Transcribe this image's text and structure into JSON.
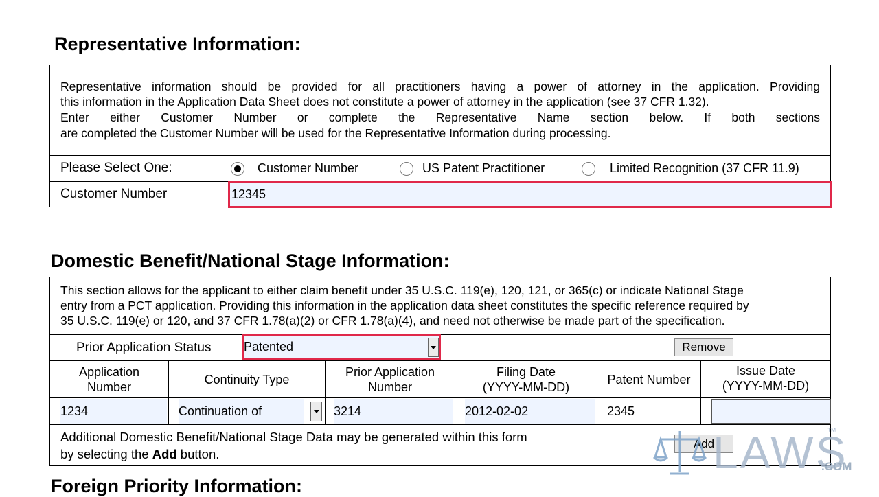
{
  "rep": {
    "heading": "Representative Information:",
    "intro_lines": [
      "Representative information should be provided for all practitioners having a power of attorney in the application. Providing",
      "this information in the Application Data Sheet does not constitute a power of attorney in the application (see 37 CFR 1.32).",
      "Enter either Customer Number or complete the Representative Name section below. If both sections",
      "are completed the Customer Number will be used for the Representative Information during processing."
    ],
    "select_label": "Please Select One:",
    "options": [
      "Customer Number",
      "US Patent Practitioner",
      "Limited Recognition (37 CFR 11.9)"
    ],
    "selected_option": "Customer Number",
    "customer_number_label": "Customer Number",
    "customer_number_value": "12345"
  },
  "domestic": {
    "heading": "Domestic Benefit/National Stage Information:",
    "intro_lines": [
      "This section allows for the applicant to either claim benefit under 35 U.S.C. 119(e), 120, 121, or 365(c) or indicate National Stage",
      "entry from a PCT application. Providing this information in the application data sheet constitutes the specific reference required by",
      "35 U.S.C. 119(e) or 120, and 37 CFR 1.78(a)(2) or CFR 1.78(a)(4), and need not otherwise be made part of the specification."
    ],
    "status_label": "Prior Application Status",
    "status_value": "Patented",
    "remove_label": "Remove",
    "columns": [
      [
        "Application",
        "Number"
      ],
      [
        "Continuity Type"
      ],
      [
        "Prior Application",
        "Number"
      ],
      [
        "Filing Date",
        "(YYYY-MM-DD)"
      ],
      [
        "Patent Number"
      ],
      [
        "Issue Date",
        "(YYYY-MM-DD)"
      ]
    ],
    "row": {
      "application_number": "1234",
      "continuity_type": "Continuation of",
      "prior_application_number": "3214",
      "filing_date": "2012-02-02",
      "patent_number": "2345",
      "issue_date": ""
    },
    "additional_text_1": "Additional Domestic Benefit/National Stage Data may be generated within this form",
    "additional_text_2_pre": "by selecting the ",
    "additional_text_2_bold": "Add",
    "additional_text_2_post": " button.",
    "add_label": "Add"
  },
  "foreign": {
    "heading": "Foreign Priority Information:"
  },
  "watermark": {
    "brand": "LAWS",
    "tm": "™",
    "suffix": ".COM",
    "color": "#a8b8cc"
  }
}
